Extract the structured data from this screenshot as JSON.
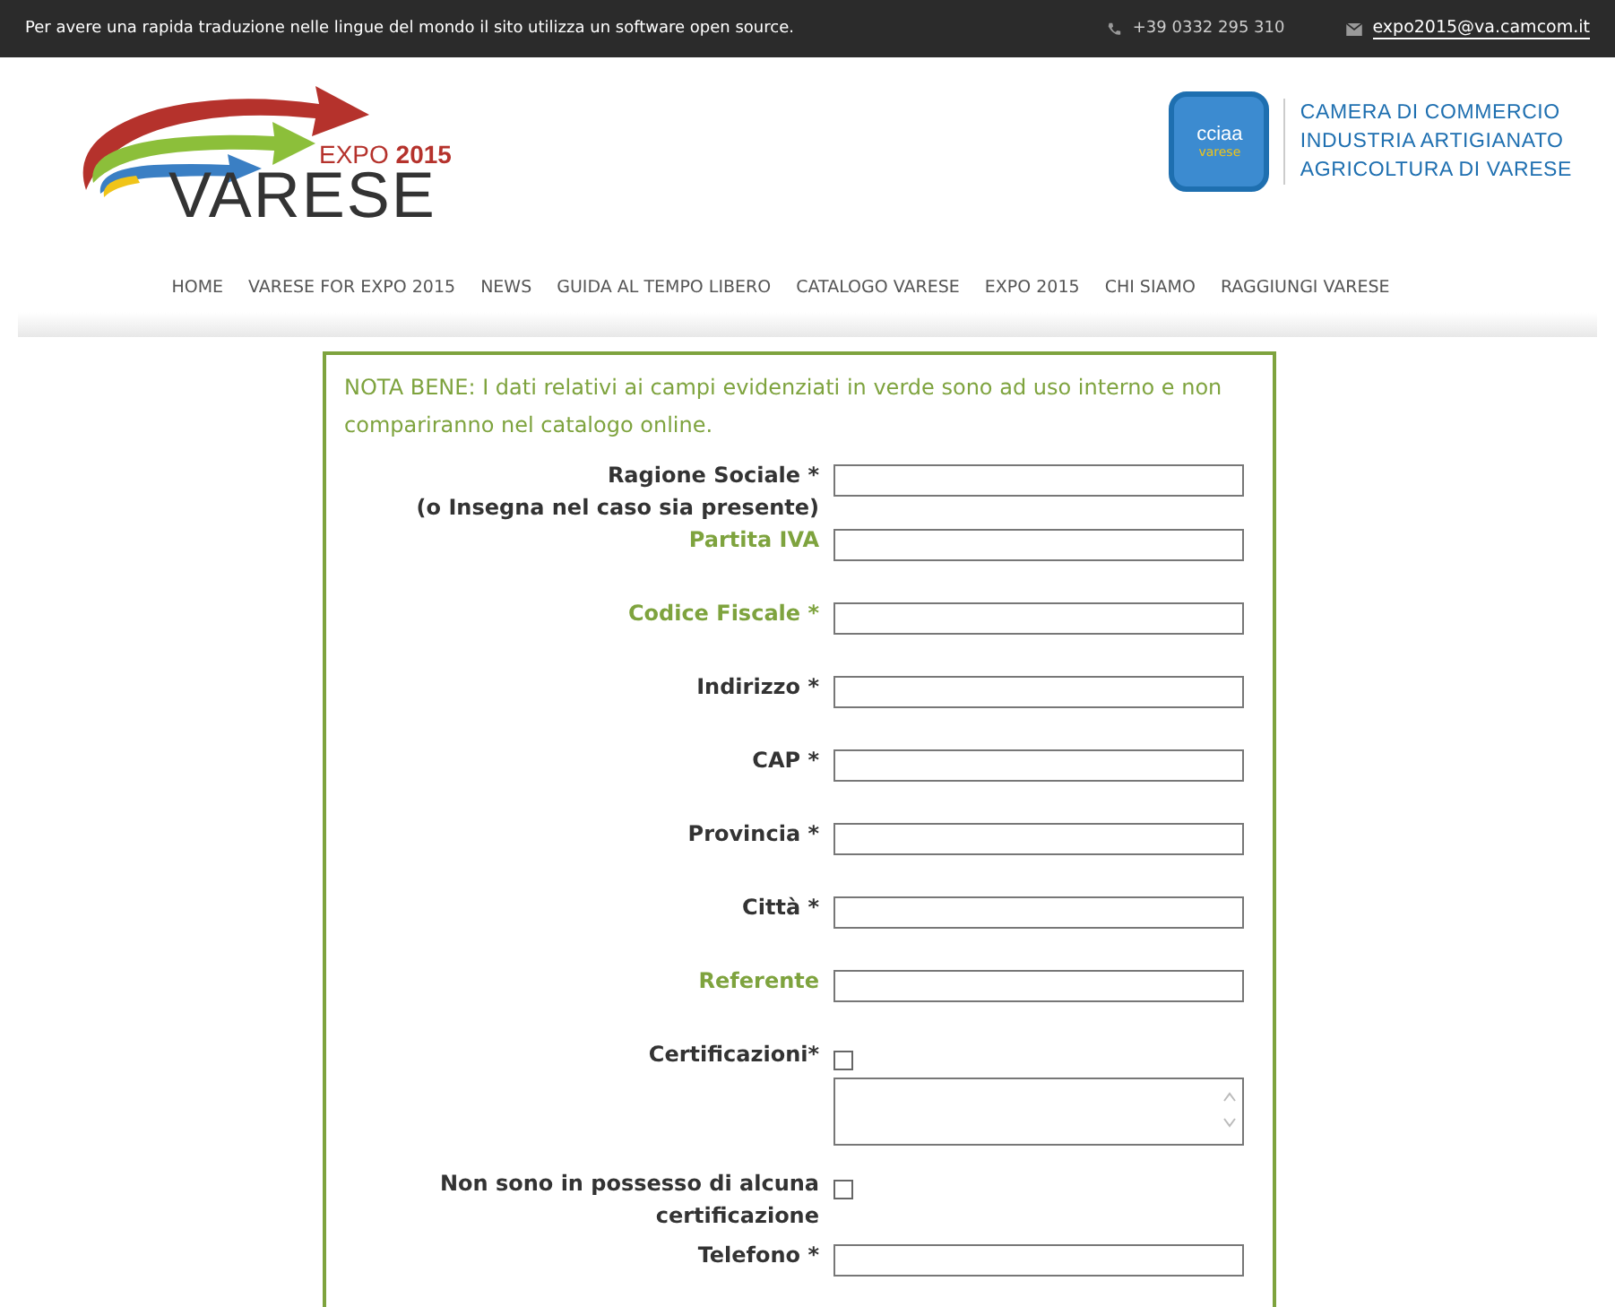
{
  "top_bar": {
    "notice": "Per avere una rapida traduzione nelle lingue del mondo il sito utilizza un software open source.",
    "phone": "+39 0332 295 310",
    "email": "expo2015@va.camcom.it"
  },
  "logo": {
    "tagline": "EXPO **2015**",
    "name": "VARESE"
  },
  "partner_logo": {
    "badge_top": "cciaa",
    "badge_bottom": "varese",
    "lines": [
      "CAMERA DI COMMERCIO",
      "INDUSTRIA ARTIGIANATO",
      "AGRICOLTURA DI VARESE"
    ]
  },
  "nav": [
    "HOME",
    "VARESE FOR EXPO 2015",
    "NEWS",
    "GUIDA AL TEMPO LIBERO",
    "CATALOGO VARESE",
    "EXPO 2015",
    "CHI SIAMO",
    "RAGGIUNGI VARESE"
  ],
  "form": {
    "note": "NOTA BENE: I dati relativi ai campi evidenziati in verde sono ad uso interno e non compariranno nel catalogo online.",
    "fields": [
      {
        "kind": "text",
        "label": "Ragione Sociale *",
        "sublabel": "(o Insegna nel caso sia presente)",
        "internal": false
      },
      {
        "kind": "text",
        "label": "Partita IVA",
        "internal": true
      },
      {
        "kind": "text",
        "label": "Codice Fiscale *",
        "internal": true
      },
      {
        "kind": "text",
        "label": "Indirizzo *",
        "internal": false
      },
      {
        "kind": "text",
        "label": "CAP *",
        "internal": false
      },
      {
        "kind": "text",
        "label": "Provincia *",
        "internal": false
      },
      {
        "kind": "text",
        "label": "Città *",
        "internal": false
      },
      {
        "kind": "text",
        "label": "Referente",
        "internal": true
      },
      {
        "kind": "checkbox",
        "label": "Certificazioni*",
        "internal": false,
        "checked": false
      },
      {
        "kind": "textarea"
      },
      {
        "kind": "checkbox",
        "label": "Non sono in possesso di alcuna certificazione",
        "internal": false,
        "checked": false
      },
      {
        "kind": "text",
        "label": "Telefono *",
        "internal": false
      }
    ]
  }
}
